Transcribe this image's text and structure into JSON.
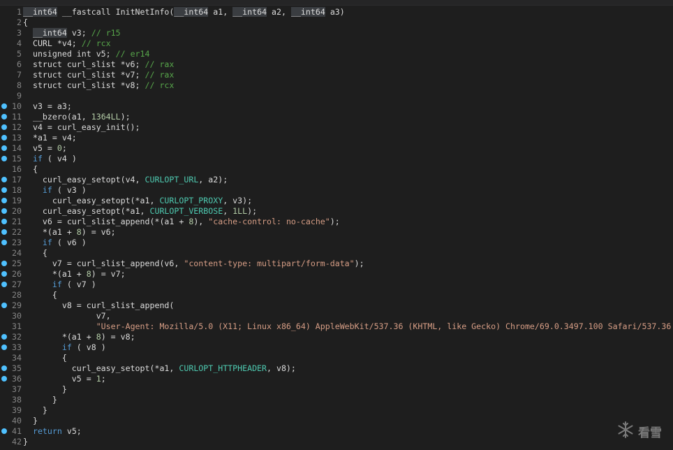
{
  "watermark": {
    "icon": "snowflake-icon",
    "text": "看雪"
  },
  "colors": {
    "background": "#1e1e1e",
    "keyword": "#569cd6",
    "comment": "#57a64a",
    "number": "#b5cea8",
    "string": "#d69d85",
    "constant": "#4ec9b0",
    "breakpoint": "#4fc1ff"
  },
  "lines": [
    {
      "n": "1",
      "bp": false,
      "segs": [
        [
          "hl",
          "__int64"
        ],
        [
          "t",
          " __fastcall InitNetInfo("
        ],
        [
          "hl",
          "__int64"
        ],
        [
          "t",
          " a1, "
        ],
        [
          "hl",
          "__int64"
        ],
        [
          "t",
          " a2, "
        ],
        [
          "hl",
          "__int64"
        ],
        [
          "t",
          " a3)"
        ]
      ]
    },
    {
      "n": "2",
      "bp": false,
      "segs": [
        [
          "t",
          "{"
        ]
      ]
    },
    {
      "n": "3",
      "bp": false,
      "segs": [
        [
          "t",
          "  "
        ],
        [
          "hl",
          "__int64"
        ],
        [
          "t",
          " v3; "
        ],
        [
          "cm",
          "// r15"
        ]
      ]
    },
    {
      "n": "4",
      "bp": false,
      "segs": [
        [
          "t",
          "  CURL *v4; "
        ],
        [
          "cm",
          "// rcx"
        ]
      ]
    },
    {
      "n": "5",
      "bp": false,
      "segs": [
        [
          "t",
          "  unsigned int v5; "
        ],
        [
          "cm",
          "// er14"
        ]
      ]
    },
    {
      "n": "6",
      "bp": false,
      "segs": [
        [
          "t",
          "  struct curl_slist *v6; "
        ],
        [
          "cm",
          "// rax"
        ]
      ]
    },
    {
      "n": "7",
      "bp": false,
      "segs": [
        [
          "t",
          "  struct curl_slist *v7; "
        ],
        [
          "cm",
          "// rax"
        ]
      ]
    },
    {
      "n": "8",
      "bp": false,
      "segs": [
        [
          "t",
          "  struct curl_slist *v8; "
        ],
        [
          "cm",
          "// rcx"
        ]
      ]
    },
    {
      "n": "9",
      "bp": false,
      "segs": [
        [
          "t",
          ""
        ]
      ]
    },
    {
      "n": "10",
      "bp": true,
      "segs": [
        [
          "t",
          "  v3 = a3;"
        ]
      ]
    },
    {
      "n": "11",
      "bp": true,
      "segs": [
        [
          "t",
          "  __bzero(a1, "
        ],
        [
          "nm",
          "1364LL"
        ],
        [
          "t",
          ");"
        ]
      ]
    },
    {
      "n": "12",
      "bp": true,
      "segs": [
        [
          "t",
          "  v4 = curl_easy_init();"
        ]
      ]
    },
    {
      "n": "13",
      "bp": true,
      "segs": [
        [
          "t",
          "  *a1 = v4;"
        ]
      ]
    },
    {
      "n": "14",
      "bp": true,
      "segs": [
        [
          "t",
          "  v5 = "
        ],
        [
          "nm",
          "0"
        ],
        [
          "t",
          ";"
        ]
      ]
    },
    {
      "n": "15",
      "bp": true,
      "segs": [
        [
          "t",
          "  "
        ],
        [
          "kw",
          "if"
        ],
        [
          "t",
          " ( v4 )"
        ]
      ]
    },
    {
      "n": "16",
      "bp": false,
      "segs": [
        [
          "t",
          "  {"
        ]
      ]
    },
    {
      "n": "17",
      "bp": true,
      "segs": [
        [
          "t",
          "    curl_easy_setopt(v4, "
        ],
        [
          "cn",
          "CURLOPT_URL"
        ],
        [
          "t",
          ", a2);"
        ]
      ]
    },
    {
      "n": "18",
      "bp": true,
      "segs": [
        [
          "t",
          "    "
        ],
        [
          "kw",
          "if"
        ],
        [
          "t",
          " ( v3 )"
        ]
      ]
    },
    {
      "n": "19",
      "bp": true,
      "segs": [
        [
          "t",
          "      curl_easy_setopt(*a1, "
        ],
        [
          "cn",
          "CURLOPT_PROXY"
        ],
        [
          "t",
          ", v3);"
        ]
      ]
    },
    {
      "n": "20",
      "bp": true,
      "segs": [
        [
          "t",
          "    curl_easy_setopt(*a1, "
        ],
        [
          "cn",
          "CURLOPT_VERBOSE"
        ],
        [
          "t",
          ", "
        ],
        [
          "nm",
          "1LL"
        ],
        [
          "t",
          ");"
        ]
      ]
    },
    {
      "n": "21",
      "bp": true,
      "segs": [
        [
          "t",
          "    v6 = curl_slist_append(*(a1 + "
        ],
        [
          "nm",
          "8"
        ],
        [
          "t",
          "), "
        ],
        [
          "st",
          "\"cache-control: no-cache\""
        ],
        [
          "t",
          ");"
        ]
      ]
    },
    {
      "n": "22",
      "bp": true,
      "segs": [
        [
          "t",
          "    *(a1 + "
        ],
        [
          "nm",
          "8"
        ],
        [
          "t",
          ") = v6;"
        ]
      ]
    },
    {
      "n": "23",
      "bp": true,
      "segs": [
        [
          "t",
          "    "
        ],
        [
          "kw",
          "if"
        ],
        [
          "t",
          " ( v6 )"
        ]
      ]
    },
    {
      "n": "24",
      "bp": false,
      "segs": [
        [
          "t",
          "    {"
        ]
      ]
    },
    {
      "n": "25",
      "bp": true,
      "segs": [
        [
          "t",
          "      v7 = curl_slist_append(v6, "
        ],
        [
          "st",
          "\"content-type: multipart/form-data\""
        ],
        [
          "t",
          ");"
        ]
      ]
    },
    {
      "n": "26",
      "bp": true,
      "segs": [
        [
          "t",
          "      *(a1 + "
        ],
        [
          "nm",
          "8"
        ],
        [
          "t",
          ") = v7;"
        ]
      ]
    },
    {
      "n": "27",
      "bp": true,
      "segs": [
        [
          "t",
          "      "
        ],
        [
          "kw",
          "if"
        ],
        [
          "t",
          " ( v7 )"
        ]
      ]
    },
    {
      "n": "28",
      "bp": false,
      "segs": [
        [
          "t",
          "      {"
        ]
      ]
    },
    {
      "n": "29",
      "bp": true,
      "segs": [
        [
          "t",
          "        v8 = curl_slist_append("
        ]
      ]
    },
    {
      "n": "30",
      "bp": false,
      "segs": [
        [
          "t",
          "               v7,"
        ]
      ]
    },
    {
      "n": "31",
      "bp": false,
      "segs": [
        [
          "t",
          "               "
        ],
        [
          "st",
          "\"User-Agent: Mozilla/5.0 (X11; Linux x86_64) AppleWebKit/537.36 (KHTML, like Gecko) Chrome/69.0.3497.100 Safari/537.36"
        ]
      ]
    },
    {
      "n": "32",
      "bp": true,
      "segs": [
        [
          "t",
          "        *(a1 + "
        ],
        [
          "nm",
          "8"
        ],
        [
          "t",
          ") = v8;"
        ]
      ]
    },
    {
      "n": "33",
      "bp": true,
      "segs": [
        [
          "t",
          "        "
        ],
        [
          "kw",
          "if"
        ],
        [
          "t",
          " ( v8 )"
        ]
      ]
    },
    {
      "n": "34",
      "bp": false,
      "segs": [
        [
          "t",
          "        {"
        ]
      ]
    },
    {
      "n": "35",
      "bp": true,
      "segs": [
        [
          "t",
          "          curl_easy_setopt(*a1, "
        ],
        [
          "cn",
          "CURLOPT_HTTPHEADER"
        ],
        [
          "t",
          ", v8);"
        ]
      ]
    },
    {
      "n": "36",
      "bp": true,
      "segs": [
        [
          "t",
          "          v5 = "
        ],
        [
          "nm",
          "1"
        ],
        [
          "t",
          ";"
        ]
      ]
    },
    {
      "n": "37",
      "bp": false,
      "segs": [
        [
          "t",
          "        }"
        ]
      ]
    },
    {
      "n": "38",
      "bp": false,
      "segs": [
        [
          "t",
          "      }"
        ]
      ]
    },
    {
      "n": "39",
      "bp": false,
      "segs": [
        [
          "t",
          "    }"
        ]
      ]
    },
    {
      "n": "40",
      "bp": false,
      "segs": [
        [
          "t",
          "  }"
        ]
      ]
    },
    {
      "n": "41",
      "bp": true,
      "segs": [
        [
          "t",
          "  "
        ],
        [
          "kw",
          "return"
        ],
        [
          "t",
          " v5;"
        ]
      ]
    },
    {
      "n": "42",
      "bp": false,
      "segs": [
        [
          "t",
          "}"
        ]
      ]
    }
  ]
}
